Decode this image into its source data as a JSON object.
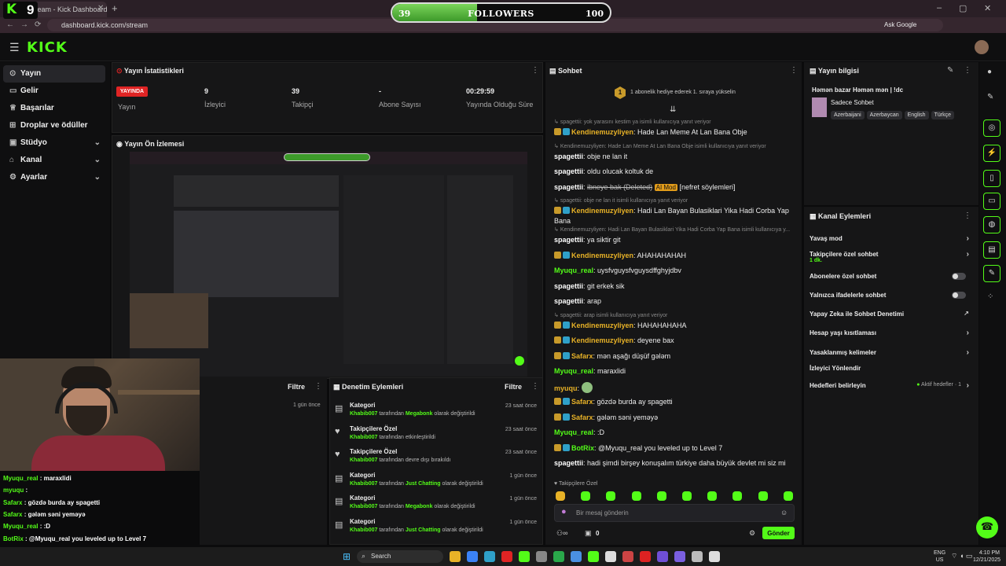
{
  "browser": {
    "tab_title": "Stream - Kick Dashboard",
    "url": "dashboard.kick.com/stream",
    "ask_google": "Ask Google"
  },
  "overlay": {
    "logo": "K",
    "viewer_count": "9",
    "followers_label": "FOLLOWERS",
    "followers_current": "39",
    "followers_goal": "100",
    "followers_progress": 0.39
  },
  "header": {
    "logo": "KICK"
  },
  "sidebar": {
    "items": [
      {
        "label": "Yayın",
        "icon": "broadcast-icon",
        "active": true,
        "chevron": false
      },
      {
        "label": "Gelir",
        "icon": "wallet-icon",
        "active": false,
        "chevron": false
      },
      {
        "label": "Başarılar",
        "icon": "trophy-icon",
        "active": false,
        "chevron": false
      },
      {
        "label": "Droplar ve ödüller",
        "icon": "gift-icon",
        "active": false,
        "chevron": false
      },
      {
        "label": "Stüdyo",
        "icon": "studio-icon",
        "active": false,
        "chevron": true
      },
      {
        "label": "Kanal",
        "icon": "channel-icon",
        "active": false,
        "chevron": true
      },
      {
        "label": "Ayarlar",
        "icon": "gear-icon",
        "active": false,
        "chevron": true
      }
    ]
  },
  "stats": {
    "title": "Yayın İstatistikleri",
    "live_badge": "YAYINDA",
    "live_label": "Yayın",
    "items": [
      {
        "value": "9",
        "label": "İzleyici"
      },
      {
        "value": "39",
        "label": "Takipçi"
      },
      {
        "value": "-",
        "label": "Abone Sayısı"
      },
      {
        "value": "00:29:59",
        "label": "Yayında Olduğu Süre"
      }
    ]
  },
  "preview": {
    "title": "Yayın Ön İzlemesi"
  },
  "stream_chat": [
    {
      "user": "Myuqu_real",
      "text": "maraxlidi",
      "color": "#53fc18"
    },
    {
      "user": "myuqu",
      "text": "",
      "color": "#53fc18"
    },
    {
      "user": "Safarx",
      "text": "gözdə burda ay spagetti",
      "color": "#53fc18"
    },
    {
      "user": "Safarx",
      "text": "gələm səni yeməyə",
      "color": "#53fc18"
    },
    {
      "user": "Myuqu_real",
      "text": ":D",
      "color": "#53fc18"
    },
    {
      "user": "BotRix",
      "text": "@Myuqu_real you leveled up to Level 7",
      "color": "#53fc18"
    },
    {
      "user": "spagettii",
      "text": "hadi şimdi birşey konuşalım türkiye daha büyük devlet mi siz mi",
      "color": "#ffffff"
    }
  ],
  "lower_left": {
    "filter": "Filtre",
    "time": "1 gün önce"
  },
  "moderation": {
    "title": "Denetim Eylemleri",
    "filter": "Filtre",
    "rows": [
      {
        "icon": "category-icon",
        "title": "Kategori",
        "user": "Khabib007",
        "mid": "tarafından",
        "value": "Megabonk",
        "rest": "olarak değiştirildi",
        "time": "23 saat önce"
      },
      {
        "icon": "heart-icon",
        "title": "Takipçilere Özel",
        "user": "Khabib007",
        "mid": "tarafından etkinleştirildi",
        "value": "",
        "rest": "",
        "time": "23 saat önce"
      },
      {
        "icon": "heart-icon",
        "title": "Takipçilere Özel",
        "user": "Khabib007",
        "mid": "tarafından devre dışı bırakıldı",
        "value": "",
        "rest": "",
        "time": "23 saat önce"
      },
      {
        "icon": "category-icon",
        "title": "Kategori",
        "user": "Khabib007",
        "mid": "tarafından",
        "value": "Just Chatting",
        "rest": "olarak değiştirildi",
        "time": "1 gün önce"
      },
      {
        "icon": "category-icon",
        "title": "Kategori",
        "user": "Khabib007",
        "mid": "tarafından",
        "value": "Megabonk",
        "rest": "olarak değiştirildi",
        "time": "1 gün önce"
      },
      {
        "icon": "category-icon",
        "title": "Kategori",
        "user": "Khabib007",
        "mid": "tarafından",
        "value": "Just Chatting",
        "rest": "olarak değiştirildi",
        "time": "1 gün önce"
      }
    ]
  },
  "chat": {
    "title": "Sohbet",
    "gift_banner": "1 abonelik hediye ederek 1. sıraya yükselin",
    "gift_rank": "1",
    "followers_only": "Takipçilere Özel",
    "input_placeholder": "Bir mesaj gönderin",
    "send": "Gönder",
    "points": "0",
    "lines": [
      {
        "reply": "spagettii: yok yarasını kestim ya isimli kullanıcıya yanıt veriyor"
      },
      {
        "user": "Kendinemuzyliyen",
        "color": "#e8b227",
        "badges": true,
        "text": "Hade Lan Meme At Lan Bana Obje"
      },
      {
        "reply": "Kendinemuzyliyen: Hade Lan Meme At Lan Bana Obje isimli kullanıcıya yanıt veriyor"
      },
      {
        "user": "spagettii",
        "color": "#ffffff",
        "text": "obje ne lan it"
      },
      {
        "user": "spagettii",
        "color": "#ffffff",
        "text": "oldu olucak koltuk de"
      },
      {
        "user": "spagettii",
        "color": "#ffffff",
        "text": "ibneye bak (Deleted)",
        "aimod": "AI Mod",
        "tail": "[nefret söylemleri]"
      },
      {
        "reply": "spagettii: obje ne lan it isimli kullanıcıya yanıt veriyor"
      },
      {
        "user": "Kendinemuzyliyen",
        "color": "#e8b227",
        "badges": true,
        "text": "Hadi Lan Bayan Bulasiklari Yika Hadi Corba Yap Bana"
      },
      {
        "reply": "Kendinemuzyliyen: Hadi Lan Bayan Bulasiklari Yika Hadi Corba Yap Bana isimli kullanıcıya y..."
      },
      {
        "user": "spagettii",
        "color": "#ffffff",
        "text": "ya siktir git"
      },
      {
        "user": "Kendinemuzyliyen",
        "color": "#e8b227",
        "badges": true,
        "text": "AHAHAHAHAH"
      },
      {
        "user": "Myuqu_real",
        "color": "#53fc18",
        "text": "uysfvguysfvguysdffghyjdbv"
      },
      {
        "user": "spagettii",
        "color": "#ffffff",
        "text": "git erkek sik"
      },
      {
        "user": "spagettii",
        "color": "#ffffff",
        "text": "arap"
      },
      {
        "reply": "spagettii: arap isimli kullanıcıya yanıt veriyor"
      },
      {
        "user": "Kendinemuzyliyen",
        "color": "#e8b227",
        "badges": true,
        "text": "HAHAHAHAHA"
      },
      {
        "user": "Kendinemuzyliyen",
        "color": "#e8b227",
        "badges": true,
        "text": "deyene bax"
      },
      {
        "user": "Safarx",
        "color": "#e8b227",
        "badges": true,
        "text": "mən aşağı düşüf gələm"
      },
      {
        "user": "Myuqu_real",
        "color": "#53fc18",
        "text": "maraxlidi"
      },
      {
        "user": "myuqu",
        "color": "#e8b227",
        "text": ""
      },
      {
        "user": "Safarx",
        "color": "#e8b227",
        "badges": true,
        "text": "gözdə burda ay spagetti"
      },
      {
        "user": "Safarx",
        "color": "#e8b227",
        "badges": true,
        "text": "gələm səni yeməyə"
      },
      {
        "user": "Myuqu_real",
        "color": "#53fc18",
        "text": ":D"
      },
      {
        "user": "BotRix",
        "color": "#53fc18",
        "badges": true,
        "text": "@Myuqu_real you leveled up to Level 7"
      },
      {
        "user": "spagettii",
        "color": "#ffffff",
        "text": "hadi şimdi birşey konuşalım türkiye daha büyük devlet mi siz mi"
      }
    ]
  },
  "info": {
    "title": "Yayın bilgisi",
    "stream_title": "Həmən bazar Həmən mən | !dc",
    "category": "Sadece Sohbet",
    "tags": [
      "Azerbaijani",
      "Azerbaycan",
      "English",
      "Türkçe"
    ]
  },
  "actions": {
    "title": "Kanal Eylemleri",
    "items": [
      {
        "label": "Yavaş mod",
        "control": "chevron",
        "sub": ""
      },
      {
        "label": "Takipçilere özel sohbet",
        "control": "chevron",
        "sub": "1 dk."
      },
      {
        "label": "Abonelere özel sohbet",
        "control": "toggle",
        "sub": ""
      },
      {
        "label": "Yalnızca ifadelerle sohbet",
        "control": "toggle",
        "sub": ""
      },
      {
        "label": "Yapay Zeka ile Sohbet Denetimi",
        "control": "external",
        "sub": ""
      },
      {
        "label": "Hesap yaşı kısıtlaması",
        "control": "chevron",
        "sub": ""
      },
      {
        "label": "Yasaklanmış kelimeler",
        "control": "chevron",
        "sub": ""
      },
      {
        "label": "İzleyici Yönlendir",
        "control": "none",
        "sub": ""
      },
      {
        "label": "Hedefleri belirleyin",
        "control": "goal",
        "sub": "Aktif hedefler · 1"
      }
    ]
  },
  "taskbar": {
    "search": "Search",
    "lang": "ENG",
    "region": "US",
    "time": "4:10 PM",
    "date": "12/21/2025"
  },
  "colors": {
    "accent": "#53fc18",
    "live": "#e02424",
    "ai_mod": "#e29c1a"
  }
}
